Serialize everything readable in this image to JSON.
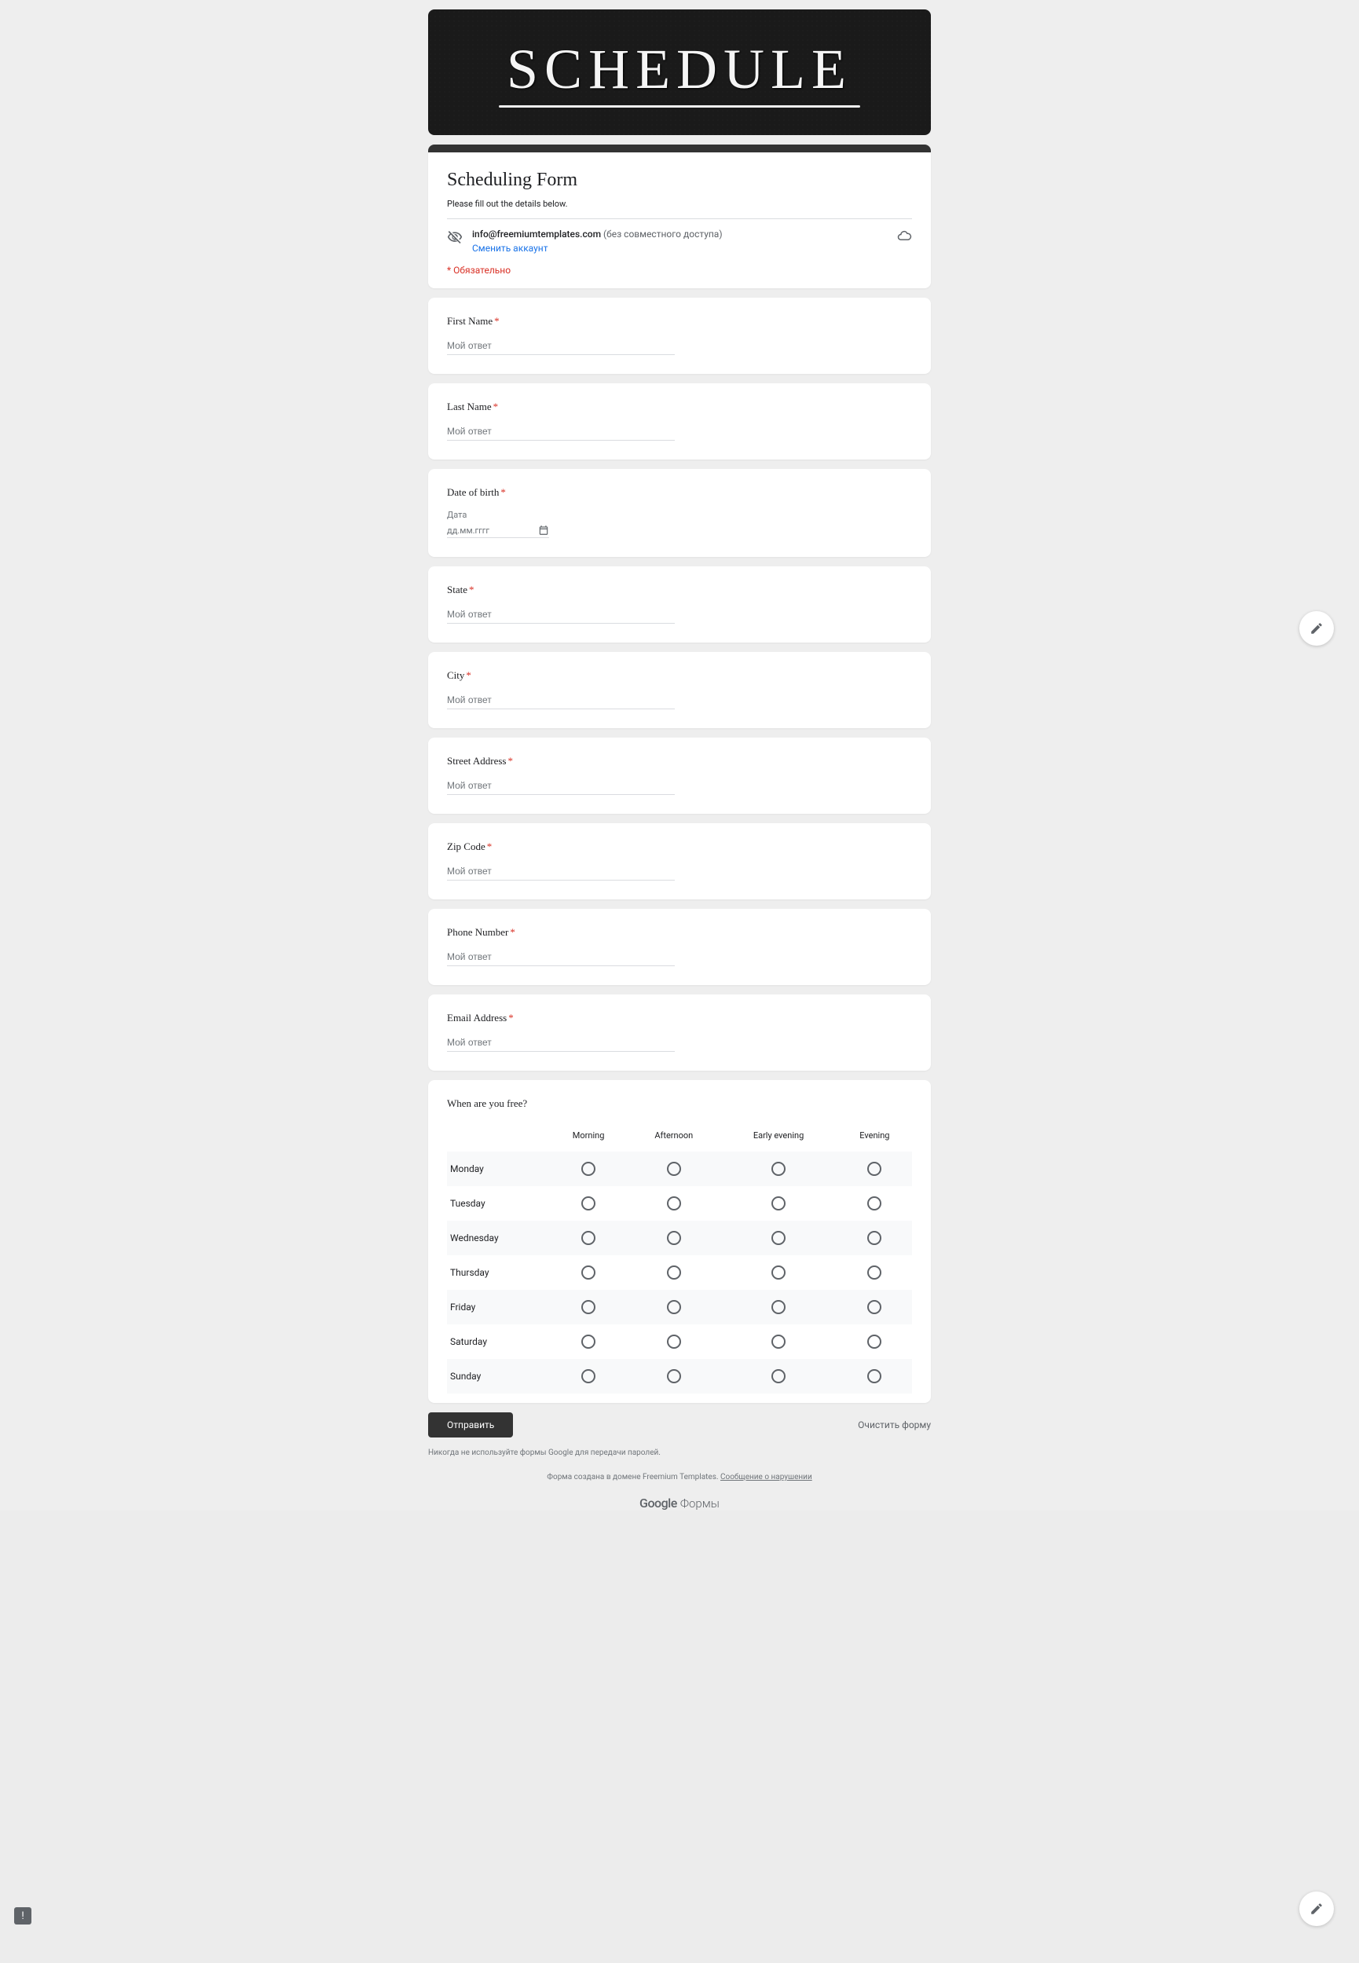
{
  "banner": {
    "title": "SCHEDULE"
  },
  "header": {
    "title": "Scheduling Form",
    "description": "Please fill out the details below.",
    "email": "info@freemiumtemplates.com",
    "sharing_note": "(без совместного доступа)",
    "switch_account": "Сменить аккаунт",
    "required_note": "* Обязательно"
  },
  "questions": {
    "first_name": {
      "label": "First Name",
      "placeholder": "Мой ответ"
    },
    "last_name": {
      "label": "Last Name",
      "placeholder": "Мой ответ"
    },
    "dob": {
      "label": "Date of birth",
      "sublabel": "Дата",
      "placeholder": "дд.мм.гггг"
    },
    "state": {
      "label": "State",
      "placeholder": "Мой ответ"
    },
    "city": {
      "label": "City",
      "placeholder": "Мой ответ"
    },
    "street": {
      "label": "Street Address",
      "placeholder": "Мой ответ"
    },
    "zip": {
      "label": "Zip Code",
      "placeholder": "Мой ответ"
    },
    "phone": {
      "label": "Phone Number",
      "placeholder": "Мой ответ"
    },
    "email": {
      "label": "Email Address",
      "placeholder": "Мой ответ"
    },
    "grid": {
      "label": "When are you free?",
      "columns": [
        "Morning",
        "Afternoon",
        "Early evening",
        "Evening"
      ],
      "rows": [
        "Monday",
        "Tuesday",
        "Wednesday",
        "Thursday",
        "Friday",
        "Saturday",
        "Sunday"
      ]
    }
  },
  "footer": {
    "submit": "Отправить",
    "clear": "Очистить форму",
    "disclaimer": "Никогда не используйте формы Google для передачи паролей.",
    "domain_note_prefix": "Форма создана в домене Freemium Templates. ",
    "report_link": "Сообщение о нарушении",
    "logo_brand": "Google",
    "logo_product": "Формы"
  }
}
